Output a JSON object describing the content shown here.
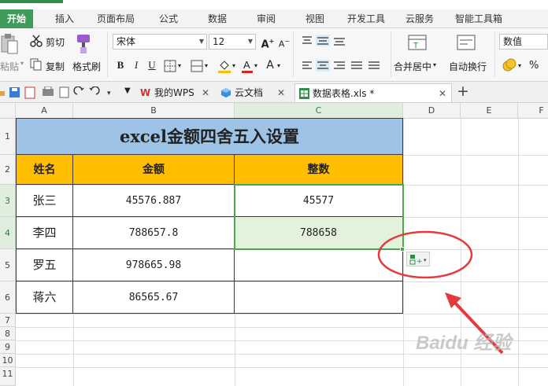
{
  "ribbon_tabs": [
    "开始",
    "插入",
    "页面布局",
    "公式",
    "数据",
    "审阅",
    "视图",
    "开发工具",
    "云服务",
    "智能工具箱"
  ],
  "clipboard": {
    "paste": "粘贴",
    "cut": "剪切",
    "copy": "复制",
    "format_painter": "格式刷"
  },
  "font": {
    "name": "宋体",
    "size": "12",
    "bold": "B",
    "italic": "I",
    "underline": "U"
  },
  "alignment": {
    "merge_center": "合并居中",
    "wrap_text": "自动换行"
  },
  "number_format": "数值",
  "doc_tabs": [
    {
      "label": "我的WPS"
    },
    {
      "label": "云文档"
    },
    {
      "label": "数据表格.xls *"
    }
  ],
  "columns": [
    "A",
    "B",
    "C",
    "D",
    "E",
    "F"
  ],
  "rows": [
    "1",
    "2",
    "3",
    "4",
    "5",
    "6",
    "7",
    "8",
    "9",
    "10",
    "11"
  ],
  "sheet": {
    "title": "excel金额四舍五入设置",
    "headers": [
      "姓名",
      "金额",
      "整数"
    ],
    "data": [
      [
        "张三",
        "45576.887",
        "45577"
      ],
      [
        "李四",
        "788657.8",
        "788658"
      ],
      [
        "罗五",
        "978665.98",
        ""
      ],
      [
        "蒋六",
        "86565.67",
        ""
      ]
    ]
  },
  "colors": {
    "title_fill": "#9dc3e6",
    "header_fill": "#ffbf00",
    "selection": "#4ca64c",
    "annotation": "#e33b3b",
    "active_tab": "#3e9b5a"
  },
  "watermark": "Baidu 经验"
}
